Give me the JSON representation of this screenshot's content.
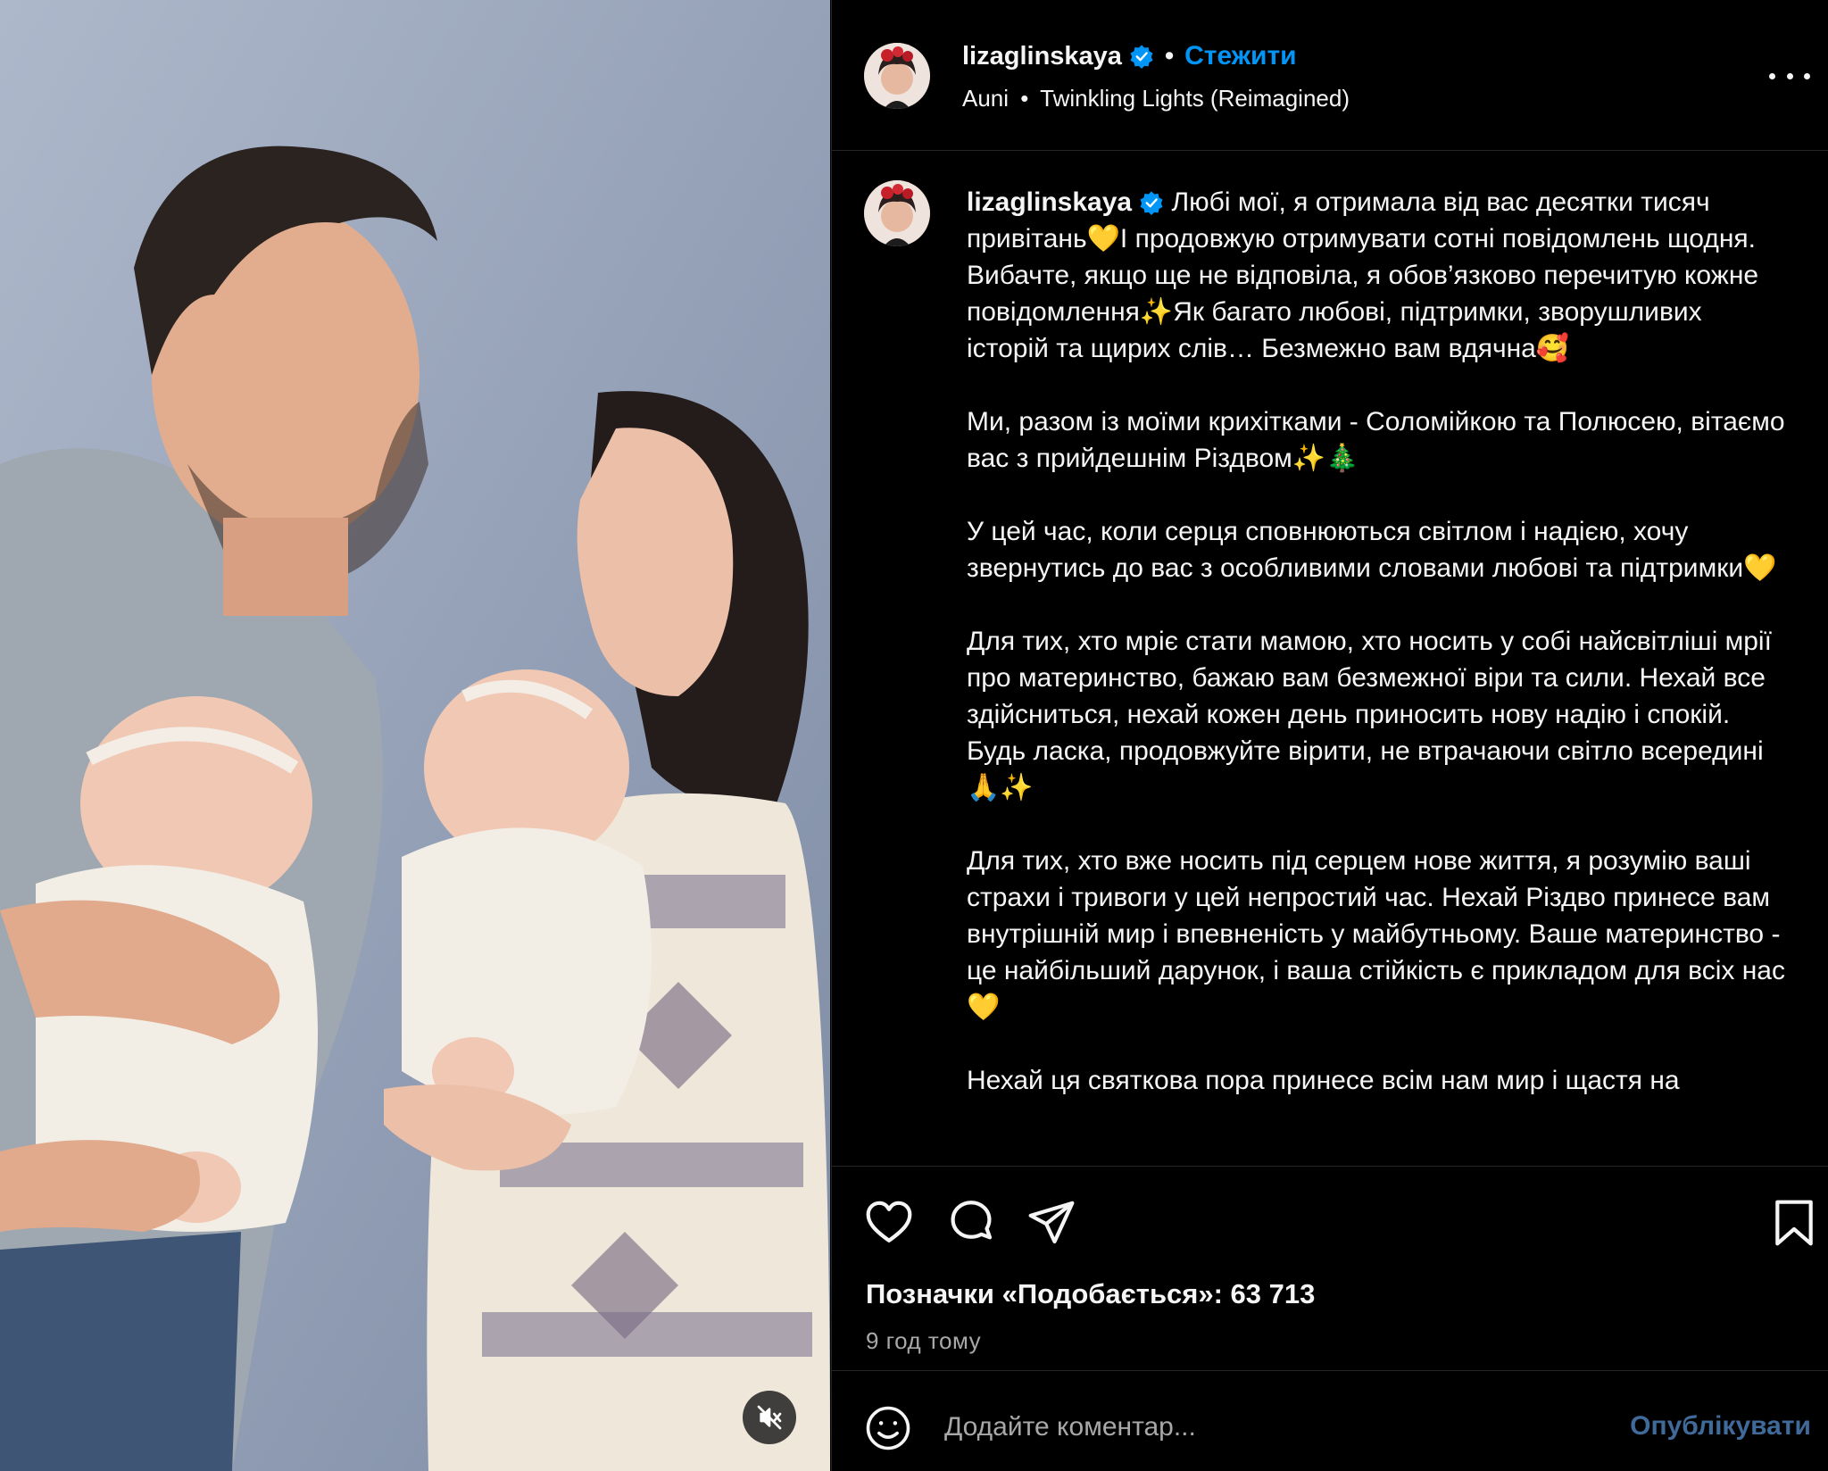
{
  "header": {
    "username": "lizaglinskaya",
    "separator": "•",
    "follow_label": "Стежити",
    "audio_artist": "Auni",
    "audio_separator": "•",
    "audio_title": "Twinkling Lights (Reimagined)"
  },
  "caption": {
    "username": "lizaglinskaya",
    "paragraphs": [
      " Любі мої, я отримала від вас десятки тисяч привітань💛І продовжую отримувати сотні повідомлень щодня. Вибачте, якщо ще не відповіла, я обов’язково перечитую кожне повідомлення✨Як багато любові, підтримки, зворушливих історій та щирих слів… Безмежно вам вдячна🥰",
      "Ми, разом із моїми крихітками - Соломійкою та Полюсею, вітаємо вас з прийдешнім Різдвом✨🎄",
      "У цей час, коли серця сповнюються світлом і надією, хочу звернутись до вас з особливими словами любові та підтримки💛",
      "Для тих, хто мріє стати мамою, хто носить у собі найсвітліші мрії про материнство, бажаю вам безмежної віри та сили. Нехай все здійсниться, нехай кожен день приносить нову надію і спокій. Будь ласка, продовжуйте вірити, не втрачаючи світло всередині 🙏✨",
      "Для тих, хто вже носить під серцем нове життя, я розумію ваші страхи і тривоги у цей непростий час. Нехай Різдво принесе вам внутрішній мир і впевненість у майбутньому. Ваше материнство - це найбільший дарунок, і ваша стійкість є прикладом для всіх нас💛",
      "Нехай ця святкова пора принесе всім нам мир і щастя на"
    ]
  },
  "stats": {
    "likes_text": "Позначки «Подобається»: 63 713",
    "time_ago": "9 год тому"
  },
  "comment": {
    "placeholder": "Додайте коментар...",
    "publish_label": "Опублікувати"
  },
  "icons": {
    "verified": "verified-badge-icon",
    "like": "heart-icon",
    "comment": "comment-bubble-icon",
    "share": "paper-plane-icon",
    "save": "bookmark-icon",
    "emoji": "emoji-smile-icon",
    "more": "more-options-icon",
    "mute": "muted-speaker-icon"
  },
  "colors": {
    "background": "#000000",
    "text": "#f5f5f5",
    "secondary_text": "#a8a8a8",
    "link": "#0095f6",
    "verified": "#0095f6",
    "publish_disabled": "#3f6a9a",
    "divider": "#262626"
  }
}
